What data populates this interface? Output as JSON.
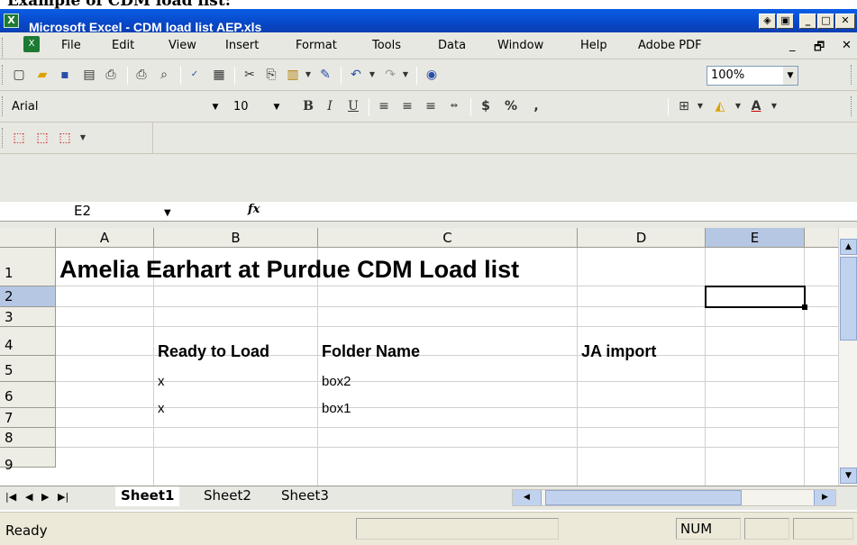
{
  "caption": "Example of CDM load list:",
  "window": {
    "title": "Microsoft Excel - CDM load list AEP.xls",
    "app_icon": "excel-icon"
  },
  "menu": [
    "File",
    "Edit",
    "View",
    "Insert",
    "Format",
    "Tools",
    "Data",
    "Window",
    "Help",
    "Adobe PDF"
  ],
  "toolbar": {
    "zoom": "100%"
  },
  "format_bar": {
    "font": "Arial",
    "size": "10",
    "currency": "$",
    "percent": "%",
    "comma": ","
  },
  "formula_bar": {
    "name_box": "E2",
    "fx_label": "fx",
    "content": ""
  },
  "columns": [
    "A",
    "B",
    "C",
    "D",
    "E"
  ],
  "rows": [
    "1",
    "2",
    "3",
    "4",
    "5",
    "6",
    "7",
    "8",
    "9"
  ],
  "cells": {
    "A1": "Amelia Earhart at Purdue CDM Load list",
    "B4": "Ready to Load",
    "C4": "Folder Name",
    "D4": "JA import",
    "B5": "x",
    "C5": "box2",
    "B6": "x",
    "C6": "box1"
  },
  "selected_cell": "E2",
  "sheets": [
    "Sheet1",
    "Sheet2",
    "Sheet3"
  ],
  "active_sheet": "Sheet1",
  "status": {
    "mode": "Ready",
    "numlock": "NUM"
  },
  "colors": {
    "title_bar": "#0848c8",
    "selection_header": "#b6c7e3",
    "excel_green": "#1c7a33"
  }
}
